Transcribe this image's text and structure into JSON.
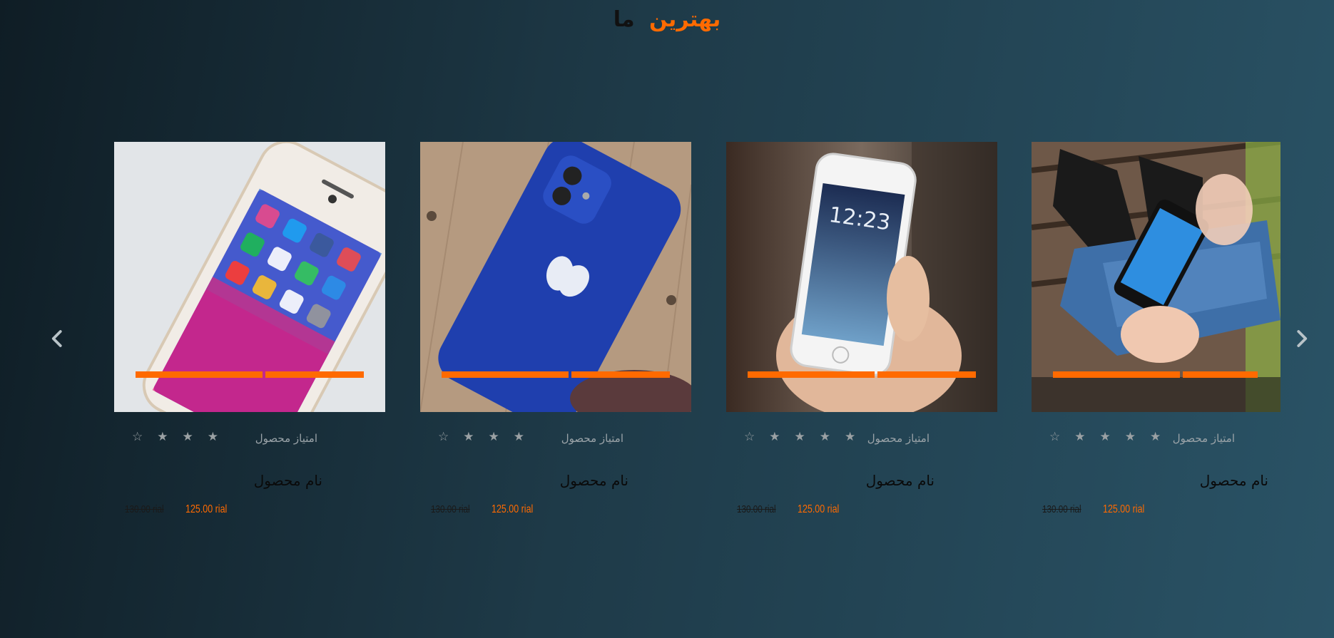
{
  "header": {
    "title_accent": "بهترین",
    "title_dark": "ما"
  },
  "nav": {
    "prev_icon": "chevron-left-icon",
    "next_icon": "chevron-right-icon"
  },
  "colors": {
    "accent": "#ff6a00",
    "star": "#9ba1a4"
  },
  "products": [
    {
      "rating_label": "امتیاز محصول",
      "rating": 3.5,
      "name": "نام محصول",
      "old_price": "130.00 rial",
      "new_price": "125.00 rial",
      "image": "iphone-screen-closeup"
    },
    {
      "rating_label": "امتیاز محصول",
      "rating": 3.5,
      "name": "نام محصول",
      "old_price": "130.00 rial",
      "new_price": "125.00 rial",
      "image": "blue-iphone-on-wood"
    },
    {
      "rating_label": "امتیاز محصول",
      "rating": 4.5,
      "name": "نام محصول",
      "old_price": "130.00 rial",
      "new_price": "125.00 rial",
      "image": "hand-holding-iphone"
    },
    {
      "rating_label": "امتیاز محصول",
      "rating": 4.5,
      "name": "نام محصول",
      "old_price": "130.00 rial",
      "new_price": "125.00 rial",
      "image": "person-on-bench-with-phone"
    }
  ]
}
